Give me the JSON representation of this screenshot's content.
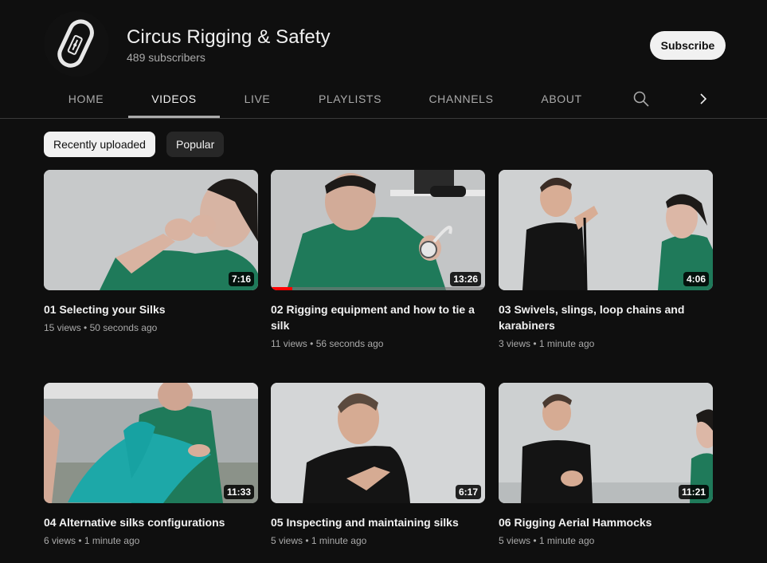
{
  "channel": {
    "name": "Circus Rigging & Safety",
    "subscribers": "489 subscribers",
    "subscribe_label": "Subscribe",
    "avatar_icon": "carabiner-icon"
  },
  "tabs": [
    {
      "label": "HOME",
      "active": false
    },
    {
      "label": "VIDEOS",
      "active": true
    },
    {
      "label": "LIVE",
      "active": false
    },
    {
      "label": "PLAYLISTS",
      "active": false
    },
    {
      "label": "CHANNELS",
      "active": false
    },
    {
      "label": "ABOUT",
      "active": false
    }
  ],
  "tab_icons": [
    "search-icon",
    "chevron-right-icon"
  ],
  "filters": [
    {
      "label": "Recently uploaded",
      "selected": true
    },
    {
      "label": "Popular",
      "selected": false
    }
  ],
  "videos": [
    {
      "title": "01 Selecting your Silks",
      "duration": "7:16",
      "views": "15 views",
      "age": "50 seconds ago",
      "watched": 0
    },
    {
      "title": "02 Rigging equipment and how to tie a silk",
      "duration": "13:26",
      "views": "11 views",
      "age": "56 seconds ago",
      "watched": 0.1
    },
    {
      "title": "03 Swivels, slings, loop chains and karabiners",
      "duration": "4:06",
      "views": "3 views",
      "age": "1 minute ago",
      "watched": 0
    },
    {
      "title": "04 Alternative silks configurations",
      "duration": "11:33",
      "views": "6 views",
      "age": "1 minute ago",
      "watched": 0
    },
    {
      "title": "05 Inspecting and maintaining silks",
      "duration": "6:17",
      "views": "5 views",
      "age": "1 minute ago",
      "watched": 0
    },
    {
      "title": "06 Rigging Aerial Hammocks",
      "duration": "11:21",
      "views": "5 views",
      "age": "1 minute ago",
      "watched": 0
    }
  ],
  "meta_separator": "•",
  "colors": {
    "background": "#0f0f0f",
    "text": "#f1f1f1",
    "secondary_text": "#aaaaaa",
    "progress": "#ff0000",
    "chip_bg": "#272727",
    "shirt_green": "#1f7a5a",
    "shirt_black": "#141414"
  }
}
